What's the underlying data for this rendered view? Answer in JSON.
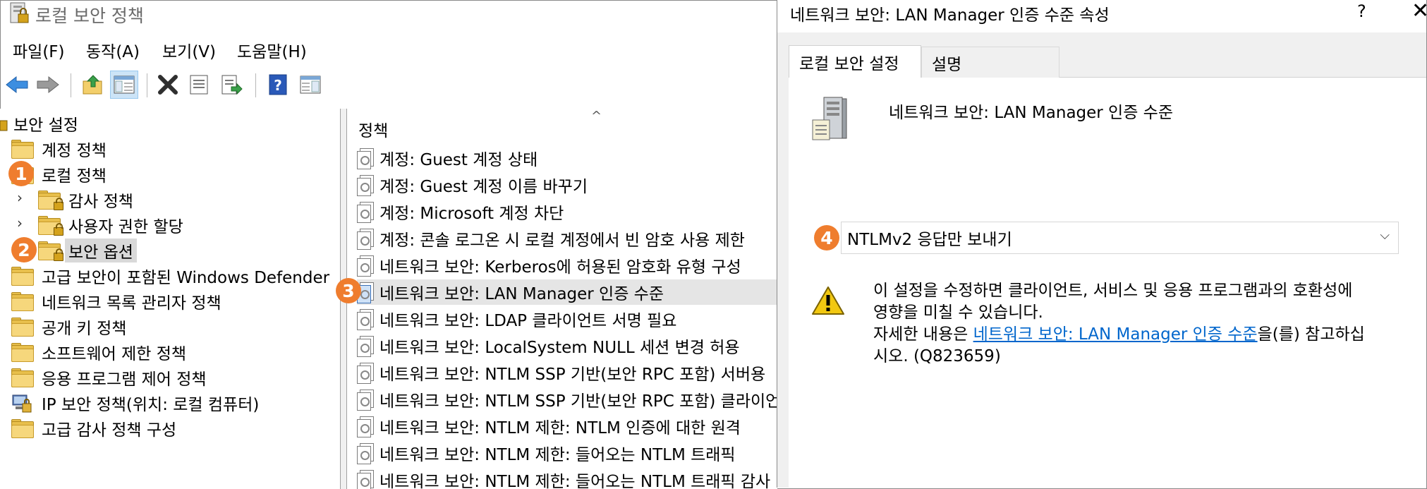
{
  "window": {
    "title": "로컬 보안 정책"
  },
  "menu": [
    "파일(F)",
    "동작(A)",
    "보기(V)",
    "도움말(H)"
  ],
  "toolbar": {
    "buttons": [
      "back-arrow-icon",
      "forward-arrow-icon",
      "up-folder-icon",
      "show-hide-tree-icon",
      "delete-icon",
      "properties-icon",
      "export-list-icon",
      "help-icon",
      "console-tree-icon"
    ]
  },
  "tree": {
    "root": "보안 설정",
    "items": [
      {
        "label": "계정 정책"
      },
      {
        "label": "로컬 정책"
      },
      {
        "label": "감사 정책"
      },
      {
        "label": "사용자 권한 할당"
      },
      {
        "label": "보안 옵션"
      },
      {
        "label": "고급 보안이 포함된 Windows Defender"
      },
      {
        "label": "네트워크 목록 관리자 정책"
      },
      {
        "label": "공개 키 정책"
      },
      {
        "label": "소프트웨어 제한 정책"
      },
      {
        "label": "응용 프로그램 제어 정책"
      },
      {
        "label": "IP 보안 정책(위치: 로컬 컴퓨터)"
      },
      {
        "label": "고급 감사 정책 구성"
      }
    ]
  },
  "list": {
    "header": "정책",
    "sort_indicator": "^",
    "rows": [
      "계정: Guest 계정 상태",
      "계정: Guest 계정 이름 바꾸기",
      "계정: Microsoft 계정 차단",
      "계정: 콘솔 로그온 시 로컬 계정에서 빈 암호 사용 제한",
      "네트워크 보안: Kerberos에 허용된 암호화 유형 구성",
      "네트워크 보안: LAN Manager 인증 수준",
      "네트워크 보안: LDAP 클라이언트 서명 필요",
      "네트워크 보안: LocalSystem NULL 세션 변경 허용",
      "네트워크 보안: NTLM SSP 기반(보안 RPC 포함) 서버용",
      "네트워크 보안: NTLM SSP 기반(보안 RPC 포함) 클라이언트",
      "네트워크 보안: NTLM 제한: NTLM 인증에 대한 원격",
      "네트워크 보안: NTLM 제한: 들어오는 NTLM 트래픽",
      "네트워크 보안: NTLM 제한: 들어오는 NTLM 트래픽 감사"
    ]
  },
  "badges": [
    "1",
    "2",
    "3",
    "4"
  ],
  "dialog": {
    "title": "네트워크 보안: LAN Manager 인증 수준 속성",
    "help": "?",
    "close": "✕",
    "tabs": [
      "로컬 보안 설정",
      "설명"
    ],
    "policy_name": "네트워크 보안: LAN Manager 인증 수준",
    "dropdown_value": "NTLMv2 응답만 보내기",
    "warning": {
      "line1": "이 설정을 수정하면 클라이언트, 서비스 및 응용 프로그램과의 호환성에",
      "line2": "영향을 미칠 수 있습니다.",
      "line3_prefix": "자세한 내용은 ",
      "link": "네트워크 보안: LAN Manager 인증 수준",
      "line3_suffix": "을(를) 참고하십",
      "line4": "시오. (Q823659)"
    }
  },
  "colors": {
    "badge": "#ef7d2e",
    "link": "#0066cc",
    "selection": "#d9d9d9"
  }
}
